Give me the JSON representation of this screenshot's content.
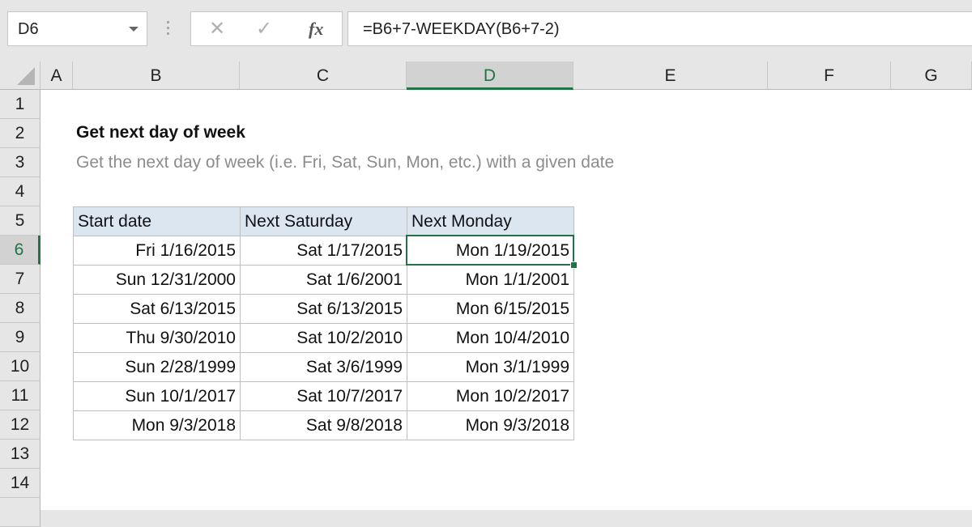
{
  "toolbar": {
    "name_box": "D6",
    "cancel_icon": "✕",
    "enter_icon": "✓",
    "function_icon": "fx",
    "formula": "=B6+7-WEEKDAY(B6+7-2)"
  },
  "columns": [
    "A",
    "B",
    "C",
    "D",
    "E",
    "F",
    "G"
  ],
  "rows": [
    "1",
    "2",
    "3",
    "4",
    "5",
    "6",
    "7",
    "8",
    "9",
    "10",
    "11",
    "12",
    "13",
    "14"
  ],
  "selected_cell": "D6",
  "sheet": {
    "title": "Get next day of week",
    "subtitle": "Get the next day of week (i.e. Fri, Sat, Sun, Mon, etc.) with a given date",
    "table": {
      "headers": [
        "Start date",
        "Next Saturday",
        "Next Monday"
      ],
      "rows": [
        [
          "Fri 1/16/2015",
          "Sat 1/17/2015",
          "Mon 1/19/2015"
        ],
        [
          "Sun 12/31/2000",
          "Sat 1/6/2001",
          "Mon 1/1/2001"
        ],
        [
          "Sat 6/13/2015",
          "Sat 6/13/2015",
          "Mon 6/15/2015"
        ],
        [
          "Thu 9/30/2010",
          "Sat 10/2/2010",
          "Mon 10/4/2010"
        ],
        [
          "Sun 2/28/1999",
          "Sat 3/6/1999",
          "Mon 3/1/1999"
        ],
        [
          "Sun 10/1/2017",
          "Sat 10/7/2017",
          "Mon 10/2/2017"
        ],
        [
          "Mon 9/3/2018",
          "Sat 9/8/2018",
          "Mon 9/3/2018"
        ]
      ]
    }
  },
  "colors": {
    "accent": "#217346",
    "header_fill": "#dce6f1"
  }
}
